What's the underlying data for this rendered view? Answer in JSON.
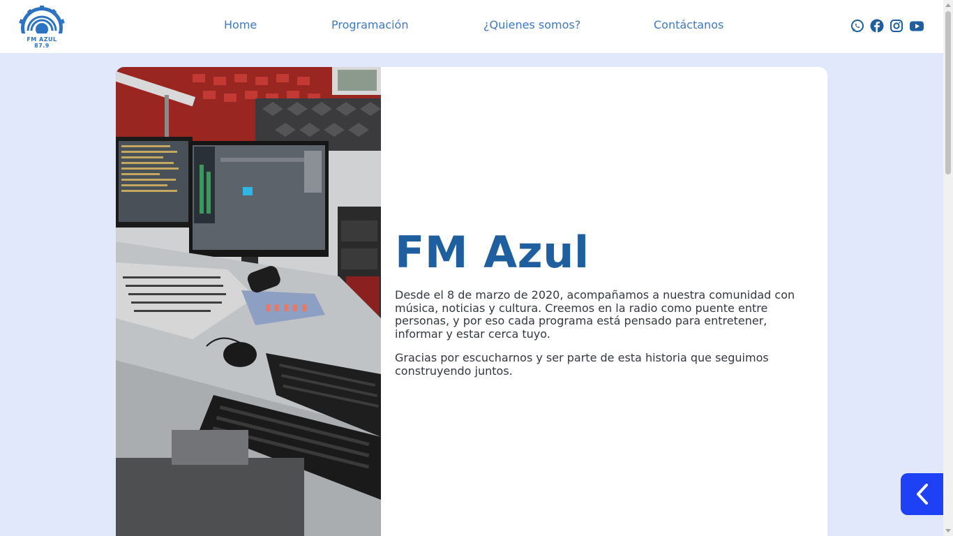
{
  "header": {
    "logo_text": "FM AZUL 87.9",
    "nav": [
      {
        "label": "Home"
      },
      {
        "label": "Programación"
      },
      {
        "label": "¿Quienes somos?"
      },
      {
        "label": "Contáctanos"
      }
    ],
    "social_icons": [
      "whatsapp-icon",
      "facebook-icon",
      "instagram-icon",
      "youtube-icon"
    ]
  },
  "about": {
    "title": "FM Azul",
    "paragraphs": [
      "Desde el 8 de marzo de 2020, acompañamos a nuestra comunidad con música, noticias y cultura. Creemos en la radio como puente entre personas, y por eso cada programa está pensado para entretener, informar y estar cerca tuyo.",
      "Gracias por escucharnos y ser parte de esta historia que seguimos construyendo juntos."
    ]
  },
  "colors": {
    "page_bg": "#e1e8fb",
    "brand_blue": "#1f5f9f",
    "nav_blue": "#3f79c0",
    "toggle_blue": "#1f41f5"
  }
}
